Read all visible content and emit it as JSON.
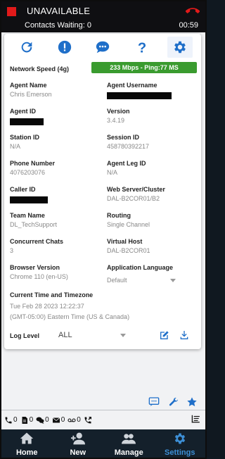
{
  "header": {
    "status": "UNAVAILABLE",
    "contacts_waiting": "Contacts Waiting: 0",
    "timer": "00:59",
    "status_color": "#e11a1a",
    "phone_icon": "phone-hangup-icon"
  },
  "toolbar": {
    "icons": [
      "refresh-icon",
      "alert-icon",
      "chat-icon",
      "help-icon",
      "gear-icon"
    ],
    "active": "gear-icon"
  },
  "network": {
    "label": "Network Speed (4g)",
    "badge": "233 Mbps - Ping:77 MS",
    "badge_color": "#3a9b2f"
  },
  "info": {
    "agent_name_label": "Agent Name",
    "agent_name": "Chris Emerson",
    "agent_username_label": "Agent Username",
    "agent_id_label": "Agent ID",
    "version_label": "Version",
    "version": "3.4.19",
    "station_id_label": "Station ID",
    "station_id": "N/A",
    "session_id_label": "Session ID",
    "session_id": "458780392217",
    "phone_number_label": "Phone Number",
    "phone_number": "4076203076",
    "agent_leg_id_label": "Agent Leg ID",
    "agent_leg_id": "N/A",
    "caller_id_label": "Caller ID",
    "web_server_label": "Web Server/Cluster",
    "web_server": "DAL-B2COR01/B2",
    "team_name_label": "Team Name",
    "team_name": "DL_TechSupport",
    "routing_label": "Routing",
    "routing": "Single Channel",
    "concurrent_chats_label": "Concurrent Chats",
    "concurrent_chats": "3",
    "virtual_host_label": "Virtual Host",
    "virtual_host": "DAL-B2COR01",
    "browser_version_label": "Browser Version",
    "browser_version": "Chrome 110 (en-US)",
    "app_language_label": "Application Language",
    "app_language": "Default",
    "current_time_label": "Current Time and Timezone",
    "current_time": "Tue Feb 28 2023 12:22:37",
    "timezone": "(GMT-05:00) Eastern Time (US & Canada)",
    "log_level_label": "Log Level",
    "log_level": "ALL"
  },
  "counts": {
    "calls": "0",
    "docs": "0",
    "chats": "0",
    "emails": "0",
    "voicemails": "0",
    "transfers": ""
  },
  "nav": {
    "items": [
      {
        "label": "Home",
        "icon": "home-icon"
      },
      {
        "label": "New",
        "icon": "add-user-icon"
      },
      {
        "label": "Manage",
        "icon": "users-icon"
      },
      {
        "label": "Settings",
        "icon": "gear-icon"
      }
    ],
    "active": "Settings",
    "active_color": "#3d8fd6"
  },
  "colors": {
    "accent": "#1f6fc9",
    "nav_bg": "#14202b"
  }
}
